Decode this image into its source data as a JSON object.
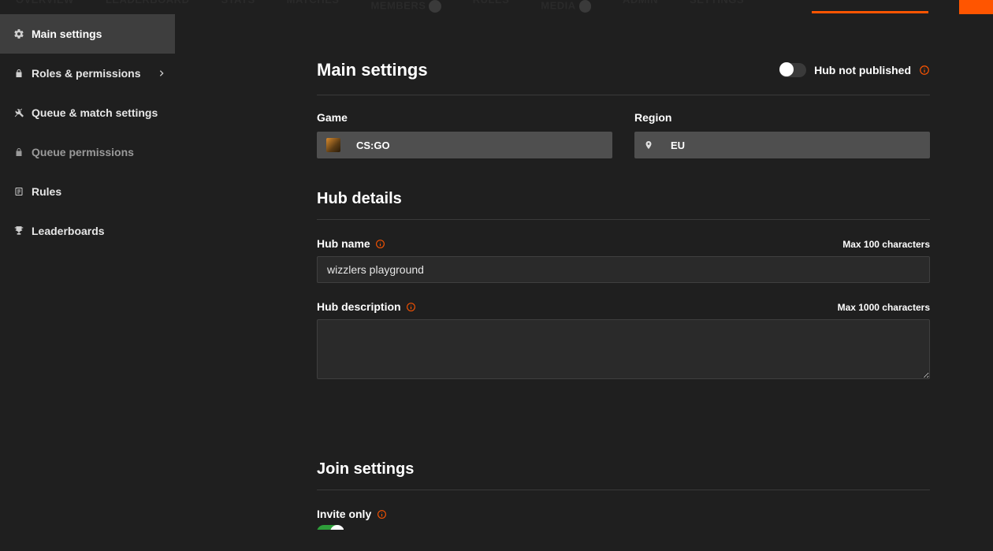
{
  "topnav": {
    "items": [
      "OVERVIEW",
      "LEADERBOARD",
      "STATS",
      "MATCHES",
      "MEMBERS",
      "RULES",
      "MEDIA",
      "ADMIN",
      "SETTINGS"
    ],
    "active_index": 8
  },
  "sidebar": {
    "items": [
      {
        "label": "Main settings",
        "icon": "gear-icon",
        "active": true
      },
      {
        "label": "Roles & permissions",
        "icon": "lock-icon",
        "chevron": true
      },
      {
        "label": "Queue & match settings",
        "icon": "tools-icon"
      },
      {
        "label": "Queue permissions",
        "icon": "lock-icon",
        "dim": true
      },
      {
        "label": "Rules",
        "icon": "doc-icon"
      },
      {
        "label": "Leaderboards",
        "icon": "trophy-icon"
      }
    ]
  },
  "main": {
    "title": "Main settings",
    "publish": {
      "label": "Hub not published",
      "on": false
    },
    "game": {
      "label": "Game",
      "value": "CS:GO"
    },
    "region": {
      "label": "Region",
      "value": "EU"
    },
    "hub_details_title": "Hub details",
    "hub_name": {
      "label": "Hub name",
      "max_note": "Max 100 characters",
      "value": "wizzlers playground"
    },
    "hub_desc": {
      "label": "Hub description",
      "max_note": "Max 1000 characters",
      "value": ""
    },
    "join_title": "Join settings",
    "invite_only": {
      "label": "Invite only",
      "on": true
    }
  }
}
